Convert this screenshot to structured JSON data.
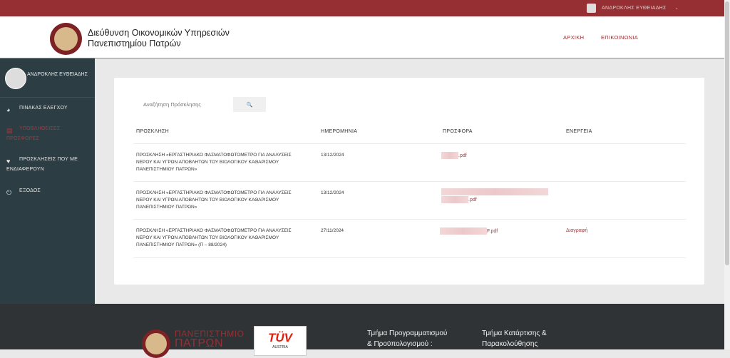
{
  "topbar": {
    "user_name": "ΑΝΔΡΟΚΛΗΣ ΕΥΘΕΙΑΔΗΣ",
    "caret": "⌄"
  },
  "header": {
    "title_line1": "Διεύθυνση Οικονομικών Υπηρεσιών",
    "title_line2": "Πανεπιστημίου Πατρών",
    "nav": [
      {
        "label": "ΑΡΧΙΚΗ"
      },
      {
        "label": "ΕΠΙΚΟΙΝΩΝΙΑ"
      }
    ]
  },
  "sidebar": {
    "user_name": "ΑΝΔΡΟΚΛΗΣ ΕΥΘΕΙΑΔΗΣ",
    "items": [
      {
        "label": "ΠΙΝΑΚΑΣ ΕΛΕΓΧΟΥ",
        "icon": "dashboard-icon",
        "glyph": "◕",
        "active": false
      },
      {
        "label": "ΥΠΟΒΛΗΘΕΙΣΕΣ ΠΡΟΣΦΟΡΕΣ",
        "icon": "document-icon",
        "glyph": "▤",
        "active": true
      },
      {
        "label": "ΠΡΟΣΚΛΗΣΕΙΣ ΠΟΥ ΜΕ ΕΝΔΙΑΦΕΡΟΥΝ",
        "icon": "heart-icon",
        "glyph": "♥",
        "active": false
      },
      {
        "label": "ΕΞΟΔΟΣ",
        "icon": "power-icon",
        "glyph": "⏻",
        "active": false
      }
    ]
  },
  "search": {
    "placeholder": "Αναζήτηση Πρόσκλησης",
    "button_glyph": "🔍"
  },
  "table": {
    "headers": [
      "ΠΡΟΣΚΛΗΣΗ",
      "ΗΜΕΡΟΜΗΝΙΑ",
      "ΠΡΟΣΦΟΡΑ",
      "ΕΝΕΡΓΕΙΑ"
    ],
    "rows": [
      {
        "invitation": "ΠΡΟΣΚΛΗΣΗ «ΕΡΓΑΣΤΗΡΙΑΚΟ ΦΑΣΜΑΤΟΦΩΤΟΜΕΤΡΟ ΓΙΑ ΑΝΑΛΥΣΕΙΣ ΝΕΡΟΥ ΚΑΙ ΥΓΡΩΝ ΑΠΟΒΛΗΤΩΝ ΤΟΥ ΒΙΟΛΟΓΙΚΟΥ ΚΑΘΑΡΙΣΜΟΥ ΠΑΝΕΠΙΣΤΗΜΙΟΥ ΠΑΤΡΩΝ»",
        "date": "13/12/2024",
        "offer": ".pdf",
        "action": ""
      },
      {
        "invitation": "ΠΡΟΣΚΛΗΣΗ «ΕΡΓΑΣΤΗΡΙΑΚΟ ΦΑΣΜΑΤΟΦΩΤΟΜΕΤΡΟ ΓΙΑ ΑΝΑΛΥΣΕΙΣ ΝΕΡΟΥ ΚΑΙ ΥΓΡΩΝ ΑΠΟΒΛΗΤΩΝ ΤΟΥ ΒΙΟΛΟΓΙΚΟΥ ΚΑΘΑΡΙΣΜΟΥ ΠΑΝΕΠΙΣΤΗΜΙΟΥ ΠΑΤΡΩΝ»",
        "date": "13/12/2024",
        "offer": ".pdf",
        "action": ""
      },
      {
        "invitation": "ΠΡΟΣΚΛΗΣΗ «ΕΡΓΑΣΤΗΡΙΑΚΟ ΦΑΣΜΑΤΟΦΩΤΟΜΕΤΡΟ ΓΙΑ ΑΝΑΛΥΣΕΙΣ ΝΕΡΟΥ ΚΑΙ ΥΓΡΩΝ ΑΠΟΒΛΗΤΩΝ ΤΟΥ ΒΙΟΛΟΓΙΚΟΥ ΚΑΘΑΡΙΣΜΟΥ ΠΑΝΕΠΙΣΤΗΜΙΟΥ ΠΑΤΡΩΝ» (Π – 88/2024)",
        "date": "27/11/2024",
        "offer": "F.pdf",
        "action": "Διαγραφή"
      }
    ]
  },
  "footer": {
    "uni_logo_line1": "ΠΑΝΕΠΙΣΤΗΜΙΟ",
    "uni_logo_line2": "ΠΑΤΡΩΝ",
    "tuv_text": "TÜV",
    "tuv_sub": "AUSTRIA",
    "col1_line1": "Τμήμα Προγραμματισμού",
    "col1_line2": "& Προϋπολογισμού :",
    "col2_line1": "Τμήμα Κατάρτισης &",
    "col2_line2": "Παρακολούθησης"
  },
  "colors": {
    "brand": "#962f33",
    "sidebar": "#2c3e44",
    "footer": "#2f3335",
    "link": "#a23a3e"
  }
}
